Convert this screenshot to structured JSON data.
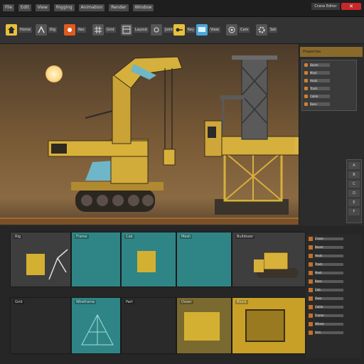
{
  "menu": [
    "File",
    "Edit",
    "View",
    "Rigging",
    "Animation",
    "Render",
    "Window"
  ],
  "window": {
    "title": "Crane Editor",
    "close_label": "✕"
  },
  "toolbar": [
    {
      "name": "home-tool",
      "label": "Home",
      "accent": "#e8c13a"
    },
    {
      "name": "rig-tool",
      "label": "Rig",
      "accent": "#9a9a9a"
    },
    {
      "name": "record-tool",
      "label": "Rec",
      "accent": "#e05a20"
    },
    {
      "name": "grid-tool",
      "label": "Grid",
      "accent": "#9a9a9a"
    },
    {
      "name": "layout-tool",
      "label": "Layout",
      "accent": "#9a9a9a"
    },
    {
      "name": "joint-tool",
      "label": "Joint",
      "accent": "#9a9a9a"
    },
    {
      "name": "key-tool",
      "label": "Key",
      "accent": "#e8c13a"
    },
    {
      "name": "screen-tool",
      "label": "View",
      "accent": "#49a6d8"
    },
    {
      "name": "camera-tool",
      "label": "Cam",
      "accent": "#9a9a9a"
    },
    {
      "name": "settings-tool",
      "label": "Set",
      "accent": "#9a9a9a"
    }
  ],
  "properties": {
    "header": "Properties",
    "rows": [
      "Boom",
      "Mast",
      "Hook",
      "Track",
      "Cable",
      "Base"
    ]
  },
  "side_tabs": [
    "A",
    "B",
    "C",
    "D",
    "E",
    "F"
  ],
  "assets": [
    {
      "label": "Rig"
    },
    {
      "label": "Frame"
    },
    {
      "label": "Cab"
    },
    {
      "label": "Mesh"
    },
    {
      "label": "Bulldozer"
    },
    {
      "label": "Grid"
    },
    {
      "label": "Wireframe"
    },
    {
      "label": "Part"
    },
    {
      "label": "Dozer"
    },
    {
      "label": "Block"
    }
  ],
  "asset_list": [
    "Crane",
    "Boom",
    "Hook",
    "Track",
    "Mast",
    "Base",
    "Cab",
    "Gear",
    "Cable",
    "Frame",
    "Wheel",
    "Arm"
  ],
  "colors": {
    "accent": "#e8c13a",
    "teal": "#2f8585",
    "close": "#c8282a"
  }
}
